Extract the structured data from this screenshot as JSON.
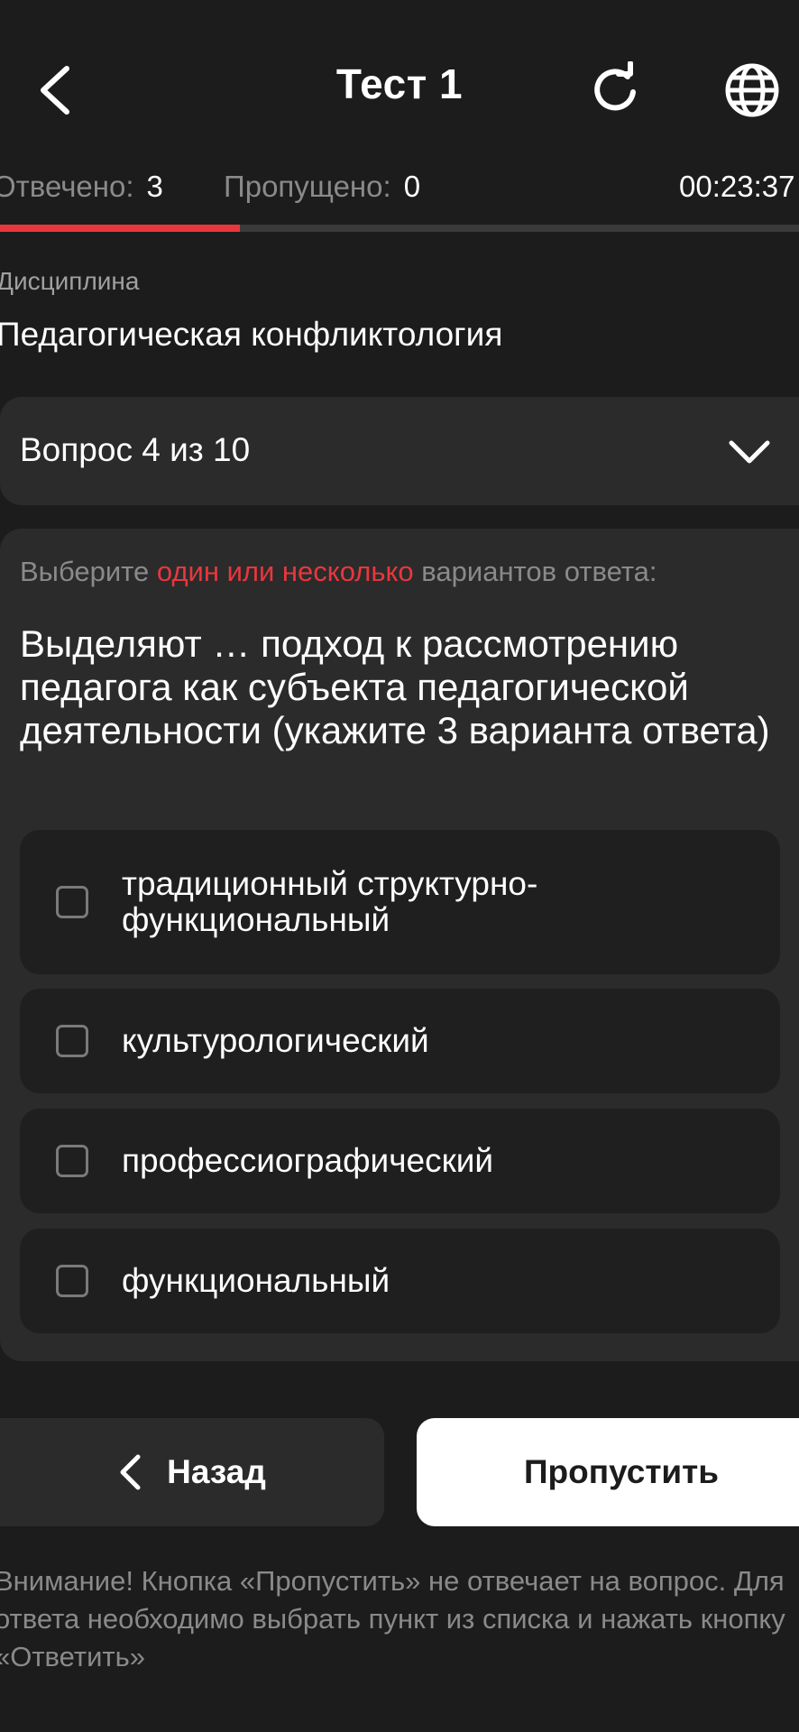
{
  "header": {
    "title": "Тест 1",
    "back_icon": "chevron-left-icon",
    "reload_icon": "reload-icon",
    "language_icon": "globe-icon"
  },
  "stats": {
    "answered_label": "Отвечено:",
    "answered_value": "3",
    "skipped_label": "Пропущено:",
    "skipped_value": "0",
    "timer": "00:23:37",
    "progress_fraction": 0.3
  },
  "discipline": {
    "label": "Дисциплина",
    "name": "Педагогическая конфликтология"
  },
  "question_selector": {
    "label": "Вопрос 4 из 10",
    "icon": "chevron-down-icon"
  },
  "question": {
    "instruction_prefix": "Выберите",
    "instruction_accent": "один или несколько",
    "instruction_suffix": "вариантов ответа:",
    "text": "Выделяют … подход к рассмотрению педагога как субъекта педагогической деятельности (укажите 3 варианта ответа)",
    "options": [
      {
        "label": "традиционный структурно-функциональный",
        "checked": false
      },
      {
        "label": "культурологический",
        "checked": false
      },
      {
        "label": "профессиографический",
        "checked": false
      },
      {
        "label": "функциональный",
        "checked": false
      }
    ]
  },
  "buttons": {
    "back_label": "Назад",
    "skip_label": "Пропустить"
  },
  "notice": "Внимание! Кнопка «Пропустить» не отвечает на вопрос. Для ответа необходимо выбрать пункт из списка и нажать кнопку «Ответить»",
  "colors": {
    "background": "#1c1c1c",
    "card": "#2b2b2b",
    "option_bg": "#1f1f1f",
    "accent": "#e8373d",
    "muted_text": "#8a8a8a"
  }
}
